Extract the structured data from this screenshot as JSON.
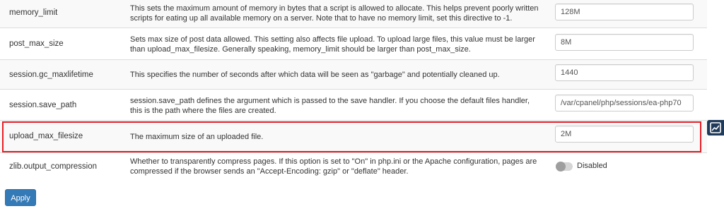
{
  "rows": [
    {
      "name": "memory_limit",
      "description": "This sets the maximum amount of memory in bytes that a script is allowed to allocate. This helps prevent poorly written scripts for eating up all available memory on a server. Note that to have no memory limit, set this directive to -1.",
      "value": "128M"
    },
    {
      "name": "post_max_size",
      "description": "Sets max size of post data allowed. This setting also affects file upload. To upload large files, this value must be larger than upload_max_filesize. Generally speaking, memory_limit should be larger than post_max_size.",
      "value": "8M"
    },
    {
      "name": "session.gc_maxlifetime",
      "description": "This specifies the number of seconds after which data will be seen as \"garbage\" and potentially cleaned up.",
      "value": "1440"
    },
    {
      "name": "session.save_path",
      "description": "session.save_path defines the argument which is passed to the save handler. If you choose the default files handler, this is the path where the files are created.",
      "value": "/var/cpanel/php/sessions/ea-php70"
    },
    {
      "name": "upload_max_filesize",
      "description": "The maximum size of an uploaded file.",
      "value": "2M"
    },
    {
      "name": "zlib.output_compression",
      "description": "Whether to transparently compress pages. If this option is set to \"On\" in php.ini or the Apache configuration, pages are compressed if the browser sends an \"Accept-Encoding: gzip\" or \"deflate\" header.",
      "toggle_label": "Disabled",
      "toggle_on": false
    }
  ],
  "apply_label": "Apply",
  "colors": {
    "highlight": "#e41e26",
    "apply": "#337ab7",
    "stats_button": "#1f3a5a"
  },
  "icons": {
    "stats": "chart-line-icon"
  }
}
